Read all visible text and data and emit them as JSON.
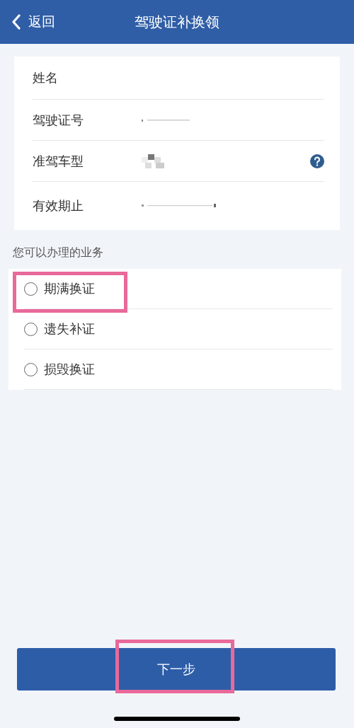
{
  "header": {
    "back": "返回",
    "title": "驾驶证补换领"
  },
  "fields": [
    {
      "label": "姓名",
      "help": false
    },
    {
      "label": "驾驶证号",
      "help": false
    },
    {
      "label": "准驾车型",
      "help": true
    },
    {
      "label": "有效期止",
      "help": false
    }
  ],
  "section_label": "您可以办理的业务",
  "options": [
    {
      "label": "期满换证",
      "selected": false,
      "highlighted": true
    },
    {
      "label": "遗失补证",
      "selected": false,
      "highlighted": false
    },
    {
      "label": "损毁换证",
      "selected": false,
      "highlighted": false
    }
  ],
  "next_button": {
    "label": "下一步",
    "highlighted": true
  }
}
